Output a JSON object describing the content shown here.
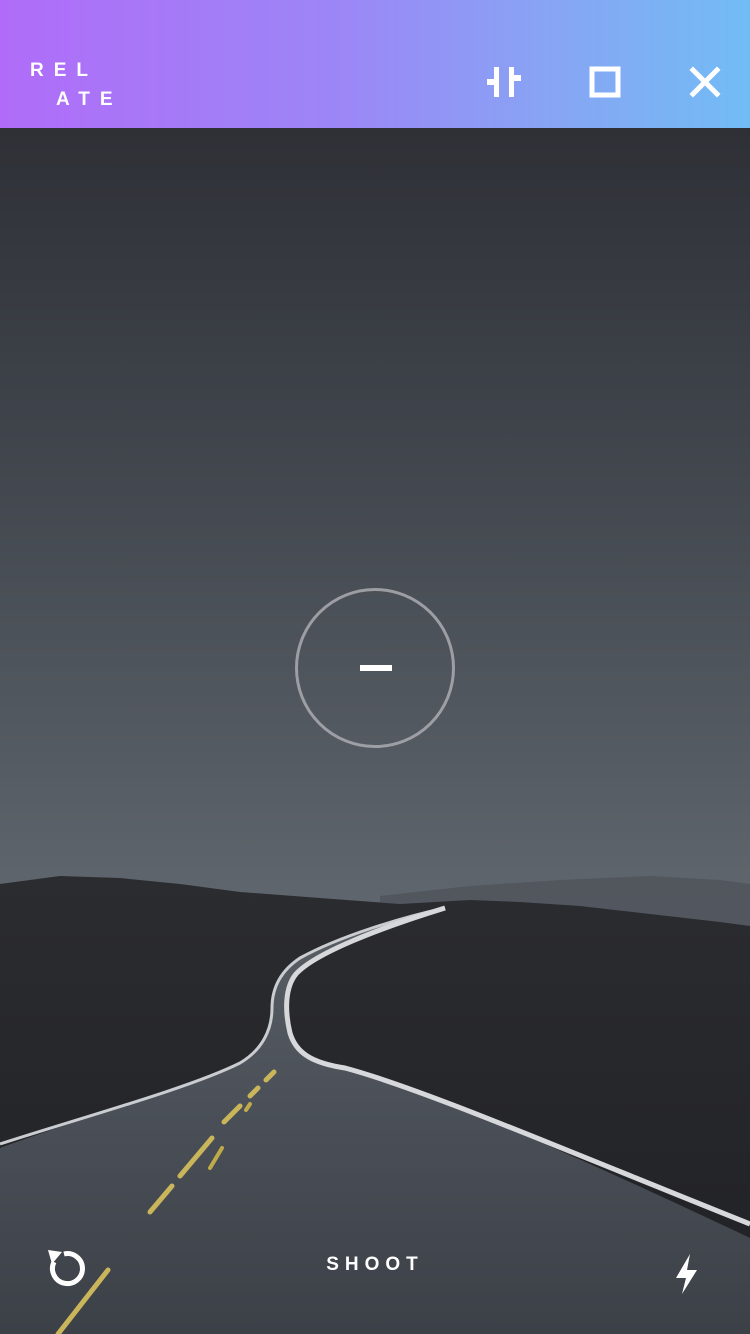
{
  "header": {
    "logo_line1": "REL",
    "logo_line2": "ATE",
    "icons": {
      "adjust": "adjust-sliders-icon",
      "crop": "crop-square-icon",
      "close": "close-icon"
    },
    "gradient_colors": [
      "#b06cf8",
      "#72bcf5"
    ]
  },
  "viewfinder": {
    "focus_icon": "minus-icon"
  },
  "footer": {
    "shoot_label": "SHOOT",
    "icons": {
      "rotate": "rotate-icon",
      "flash": "flash-icon"
    }
  }
}
